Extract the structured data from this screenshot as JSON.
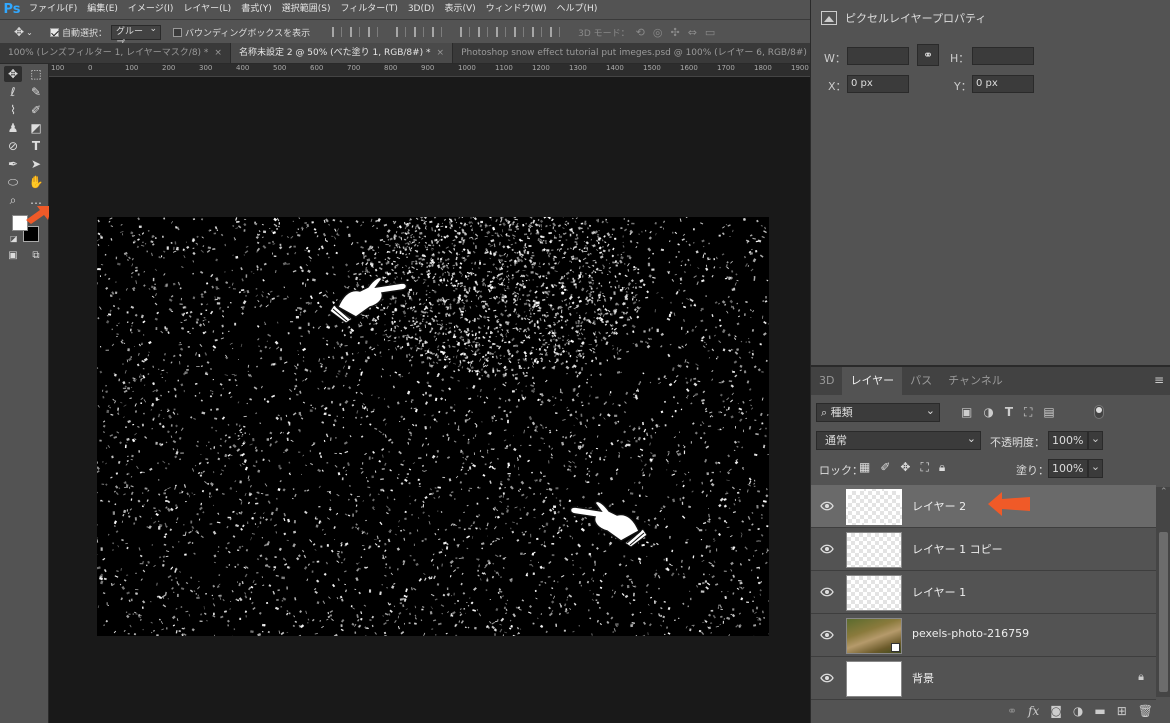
{
  "app": {
    "logo": "Ps"
  },
  "menu": [
    "ファイル(F)",
    "編集(E)",
    "イメージ(I)",
    "レイヤー(L)",
    "書式(Y)",
    "選択範囲(S)",
    "フィルター(T)",
    "3D(D)",
    "表示(V)",
    "ウィンドウ(W)",
    "ヘルプ(H)"
  ],
  "options": {
    "auto_select_label": "自動選択：",
    "auto_select_value": "グループ",
    "bounding_box_label": "バウンディングボックスを表示",
    "mode_3d_label": "3D モード："
  },
  "tabs": [
    {
      "label": "100% (レンズフィルター 1, レイヤーマスク/8) *",
      "active": false
    },
    {
      "label": "名称未設定 2 @ 50% (べた塗り 1, RGB/8#) *",
      "active": true
    },
    {
      "label": "Photoshop snow effect tutorial put imeges.psd @ 100% (レイヤー 6, RGB/8#) *",
      "active": false
    }
  ],
  "ruler_ticks": [
    "100",
    "0",
    "100",
    "200",
    "300",
    "400",
    "500",
    "600",
    "700",
    "800",
    "900",
    "1000",
    "1100",
    "1200",
    "1300",
    "1400",
    "1500",
    "1600",
    "1700",
    "1800",
    "1900"
  ],
  "properties": {
    "title": "ピクセルレイヤープロパティ",
    "w_label": "W：",
    "w_value": "",
    "h_label": "H：",
    "h_value": "",
    "x_label": "X：",
    "x_value": "0 px",
    "y_label": "Y：",
    "y_value": "0 px"
  },
  "layers_panel": {
    "tabs": [
      {
        "label": "3D",
        "active": false
      },
      {
        "label": "レイヤー",
        "active": true
      },
      {
        "label": "パス",
        "active": false
      },
      {
        "label": "チャンネル",
        "active": false
      }
    ],
    "filter_kind": "種類",
    "blend_mode": "通常",
    "opacity_label": "不透明度：",
    "opacity_value": "100%",
    "lock_label": "ロック：",
    "fill_label": "塗り：",
    "fill_value": "100%",
    "layers": [
      {
        "name": "レイヤー 2",
        "selected": true,
        "thumb": "transparent",
        "locked": false
      },
      {
        "name": "レイヤー 1 コピー",
        "selected": false,
        "thumb": "transparent",
        "locked": false
      },
      {
        "name": "レイヤー 1",
        "selected": false,
        "thumb": "transparent",
        "locked": false
      },
      {
        "name": "pexels-photo-216759",
        "selected": false,
        "thumb": "photo",
        "locked": false
      },
      {
        "name": "背景",
        "selected": false,
        "thumb": "white",
        "locked": true
      }
    ]
  },
  "colors": {
    "accent_arrow": "#f05a28",
    "panel_bg": "#535353",
    "canvas_bg": "#000000",
    "ps_blue": "#31a8ff"
  }
}
